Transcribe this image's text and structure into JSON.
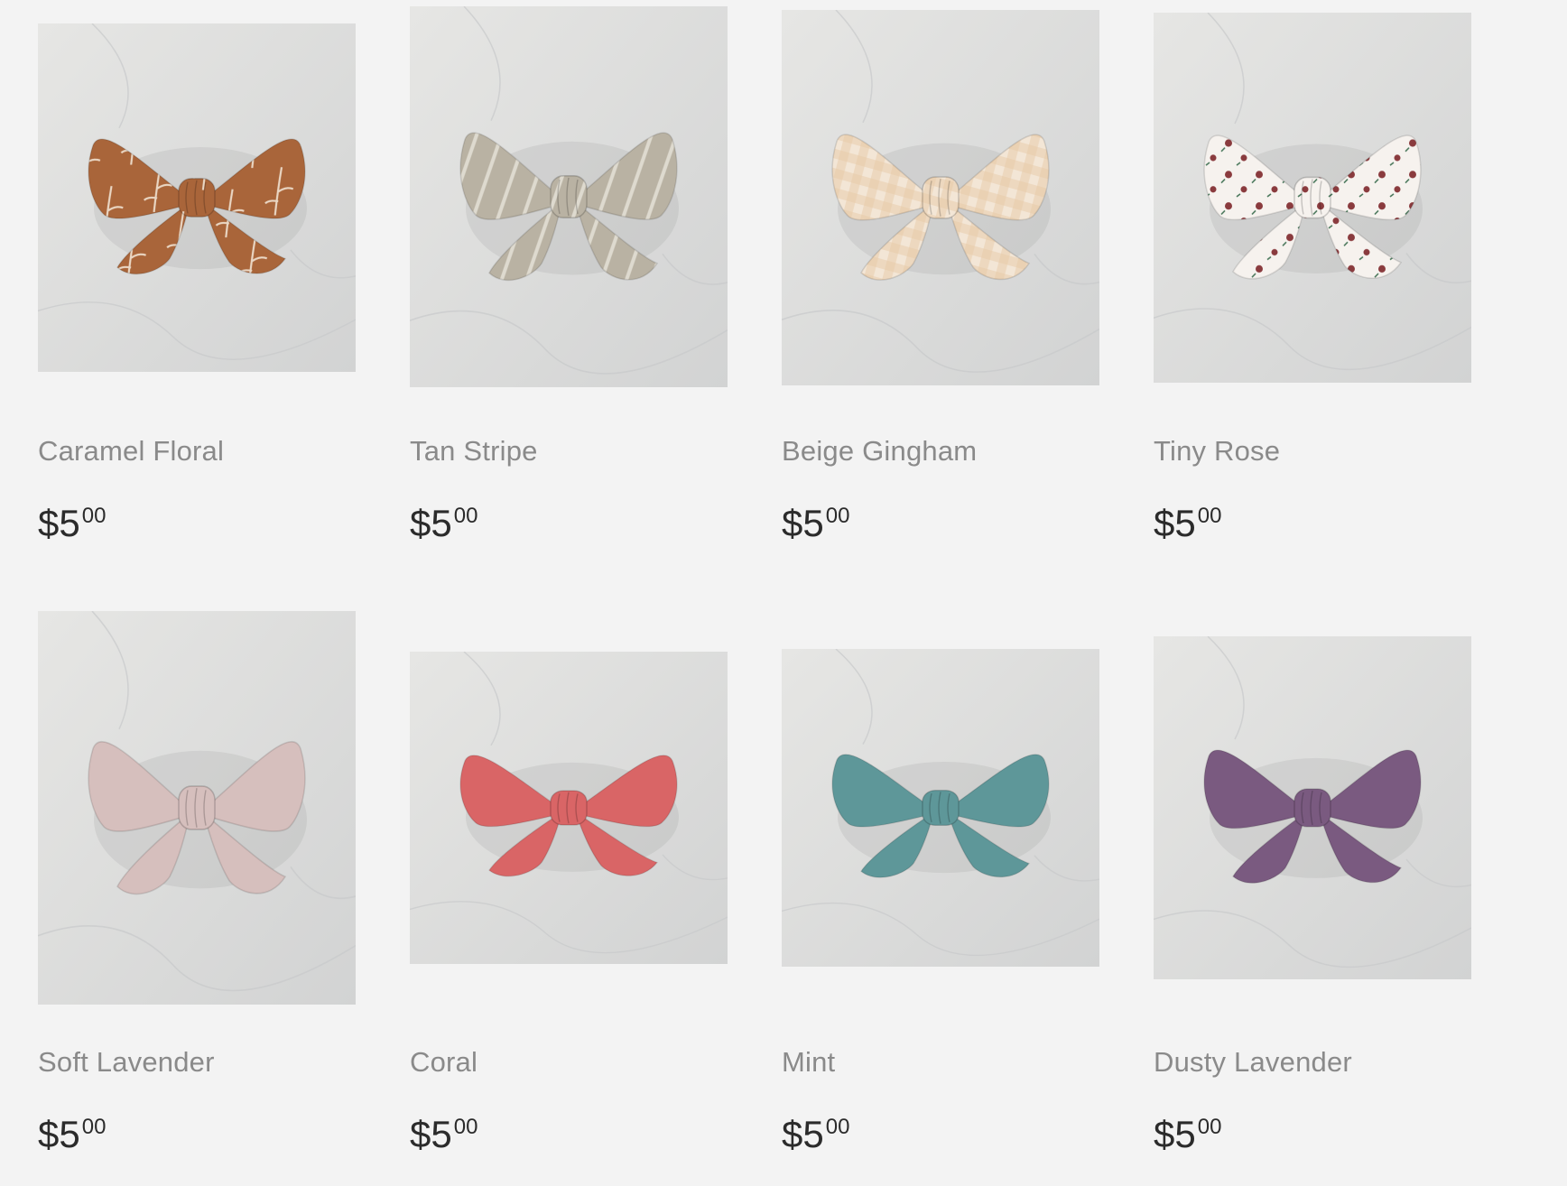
{
  "products": [
    {
      "name": "Caramel Floral",
      "price_currency": "$",
      "price_dollars": "5",
      "price_cents": "00",
      "bow_color": "#a9653a",
      "accent_color": "#ead7c4",
      "pattern": "floral-sprig"
    },
    {
      "name": "Tan Stripe",
      "price_currency": "$",
      "price_dollars": "5",
      "price_cents": "00",
      "bow_color": "#b9b2a3",
      "accent_color": "#e7e3da",
      "pattern": "stripe"
    },
    {
      "name": "Beige Gingham",
      "price_currency": "$",
      "price_dollars": "5",
      "price_cents": "00",
      "bow_color": "#f3e6d6",
      "accent_color": "#e8c9a5",
      "pattern": "gingham"
    },
    {
      "name": "Tiny Rose",
      "price_currency": "$",
      "price_dollars": "5",
      "price_cents": "00",
      "bow_color": "#f6f2ee",
      "accent_color": "#8a3b3e",
      "pattern": "floral-dots"
    },
    {
      "name": "Soft Lavender",
      "price_currency": "$",
      "price_dollars": "5",
      "price_cents": "00",
      "bow_color": "#d6bfbd",
      "accent_color": "#c9aeab",
      "pattern": "solid"
    },
    {
      "name": "Coral",
      "price_currency": "$",
      "price_dollars": "5",
      "price_cents": "00",
      "bow_color": "#d96566",
      "accent_color": "#c85455",
      "pattern": "solid"
    },
    {
      "name": "Mint",
      "price_currency": "$",
      "price_dollars": "5",
      "price_cents": "00",
      "bow_color": "#5e9799",
      "accent_color": "#4d8587",
      "pattern": "solid"
    },
    {
      "name": "Dusty Lavender",
      "price_currency": "$",
      "price_dollars": "5",
      "price_cents": "00",
      "bow_color": "#7a5a80",
      "accent_color": "#68496e",
      "pattern": "solid"
    }
  ],
  "theme": {
    "background": "#f3f3f3",
    "title_color": "#8a8a8a",
    "price_color": "#2b2b2b",
    "photo_backdrop": "#dcdcdc"
  }
}
